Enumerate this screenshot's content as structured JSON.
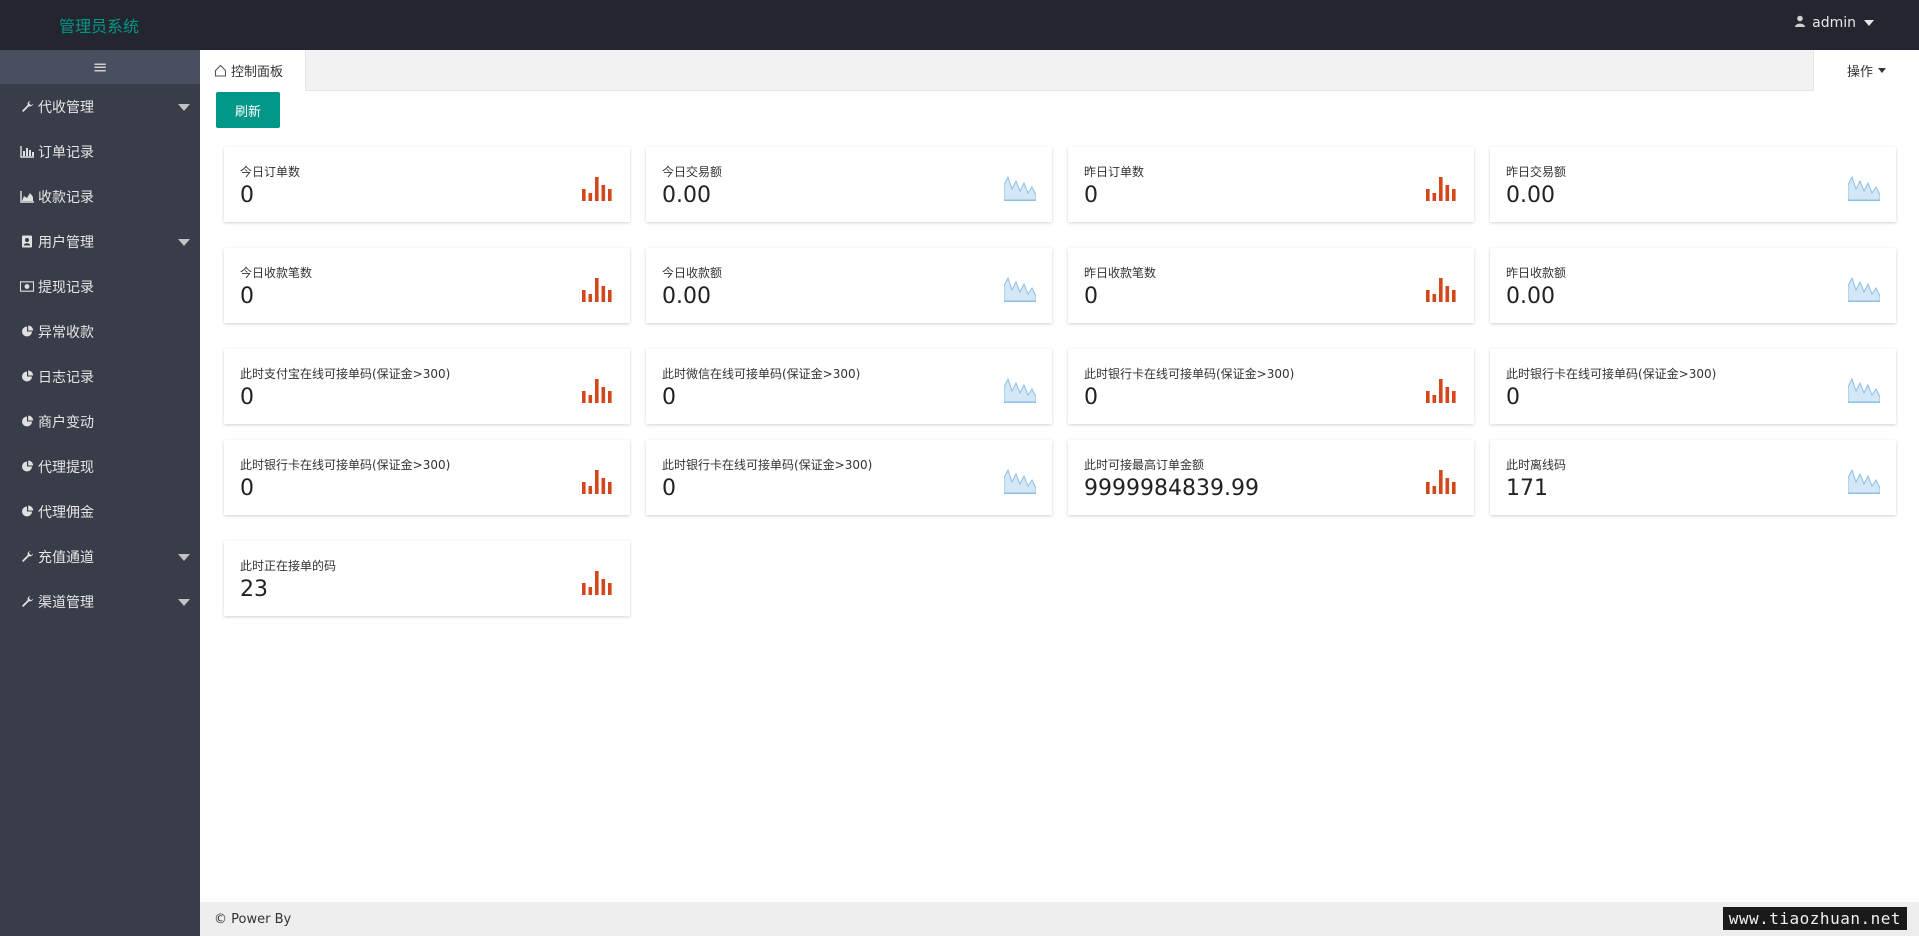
{
  "header": {
    "title": "管理员系统",
    "user": "admin"
  },
  "sidebar": {
    "toggle_glyph": "≡",
    "items": [
      {
        "label": "代收管理",
        "icon": "wrench-icon",
        "has_arrow": true
      },
      {
        "label": "订单记录",
        "icon": "bar-chart-icon",
        "has_arrow": false
      },
      {
        "label": "收款记录",
        "icon": "area-chart-icon",
        "has_arrow": false
      },
      {
        "label": "用户管理",
        "icon": "address-book-icon",
        "has_arrow": true
      },
      {
        "label": "提现记录",
        "icon": "money-icon",
        "has_arrow": false
      },
      {
        "label": "异常收款",
        "icon": "pie-chart-icon",
        "has_arrow": false
      },
      {
        "label": "日志记录",
        "icon": "pie-chart-icon",
        "has_arrow": false
      },
      {
        "label": "商户变动",
        "icon": "pie-chart-icon",
        "has_arrow": false
      },
      {
        "label": "代理提现",
        "icon": "pie-chart-icon",
        "has_arrow": false
      },
      {
        "label": "代理佣金",
        "icon": "pie-chart-icon",
        "has_arrow": false
      },
      {
        "label": "充值通道",
        "icon": "wrench-icon",
        "has_arrow": true
      },
      {
        "label": "渠道管理",
        "icon": "wrench-icon",
        "has_arrow": true
      }
    ]
  },
  "tabs": {
    "active": "控制面板",
    "ops": "操作"
  },
  "toolbar": {
    "refresh": "刷新"
  },
  "stats": [
    {
      "label": "今日订单数",
      "value": "0",
      "chart": "bar"
    },
    {
      "label": "今日交易额",
      "value": "0.00",
      "chart": "area"
    },
    {
      "label": "昨日订单数",
      "value": "0",
      "chart": "bar"
    },
    {
      "label": "昨日交易额",
      "value": "0.00",
      "chart": "area"
    },
    {
      "label": "今日收款笔数",
      "value": "0",
      "chart": "bar"
    },
    {
      "label": "今日收款额",
      "value": "0.00",
      "chart": "area"
    },
    {
      "label": "昨日收款笔数",
      "value": "0",
      "chart": "bar"
    },
    {
      "label": "昨日收款额",
      "value": "0.00",
      "chart": "area"
    },
    {
      "label": "此时支付宝在线可接单码(保证金>300)",
      "value": "0",
      "chart": "bar"
    },
    {
      "label": "此时微信在线可接单码(保证金>300)",
      "value": "0",
      "chart": "area"
    },
    {
      "label": "此时银行卡在线可接单码(保证金>300)",
      "value": "0",
      "chart": "bar"
    },
    {
      "label": "此时银行卡在线可接单码(保证金>300)",
      "value": "0",
      "chart": "area"
    },
    {
      "label": "此时银行卡在线可接单码(保证金>300)",
      "value": "0",
      "chart": "bar"
    },
    {
      "label": "此时银行卡在线可接单码(保证金>300)",
      "value": "0",
      "chart": "area"
    },
    {
      "label": "此时可接最高订单金额",
      "value": "9999984839.99",
      "chart": "bar"
    },
    {
      "label": "此时离线码",
      "value": "171",
      "chart": "area"
    },
    {
      "label": "此时正在接单的码",
      "value": "23",
      "chart": "bar"
    }
  ],
  "colors": {
    "accent": "#009688",
    "bar_icon": "#d4471b",
    "area_icon": "#8dc0e6"
  },
  "footer": {
    "text": "© Power By",
    "watermark": "www.tiaozhuan.net"
  }
}
